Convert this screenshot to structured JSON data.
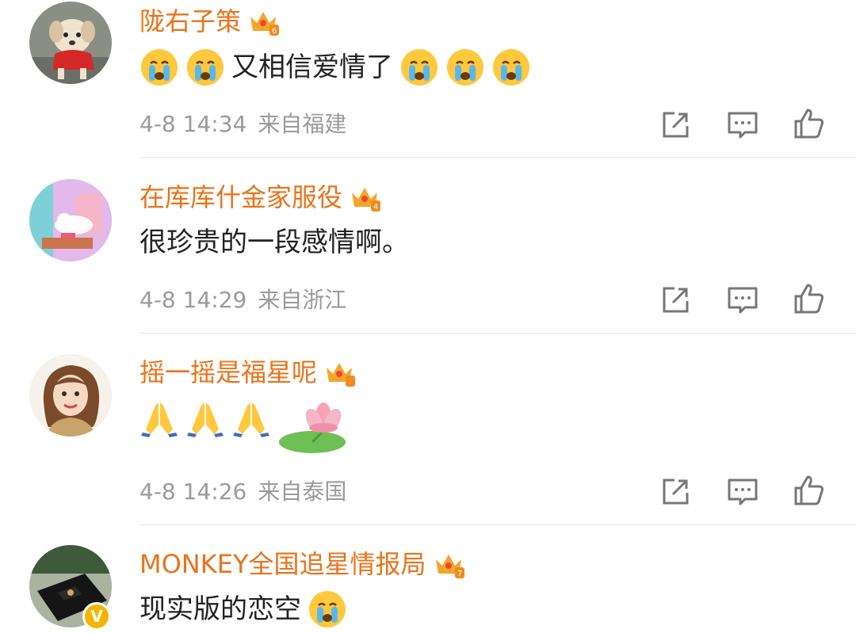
{
  "comments": [
    {
      "username": "陇右子策",
      "badge_level": "6",
      "content_emoji_before": [
        "cry-emoji",
        "cry-emoji"
      ],
      "content_text": "又相信爱情了",
      "content_emoji_after": [
        "cry-emoji",
        "cry-emoji",
        "cry-emoji"
      ],
      "date": "4-8 14:34",
      "location": "来自福建"
    },
    {
      "username": "在库库什金家服役",
      "badge_level": "4",
      "content_text": "很珍贵的一段感情啊。",
      "date": "4-8 14:29",
      "location": "来自浙江"
    },
    {
      "username": "摇一摇是福星呢",
      "badge_level": "",
      "content_emoji": [
        "pray-emoji",
        "pray-emoji",
        "pray-emoji",
        "lotus-emoji"
      ],
      "date": "4-8 14:26",
      "location": "来自泰国"
    },
    {
      "username": "MONKEY全国追星情报局",
      "badge_level": "7",
      "content_text": "现实版的恋空",
      "content_emoji_after": [
        "cry-emoji"
      ],
      "verified": "V"
    }
  ],
  "colors": {
    "username": "#e8731a",
    "meta_text": "#9a9a9a",
    "divider": "#e6e6e6",
    "verified_badge": "#f5b400"
  }
}
